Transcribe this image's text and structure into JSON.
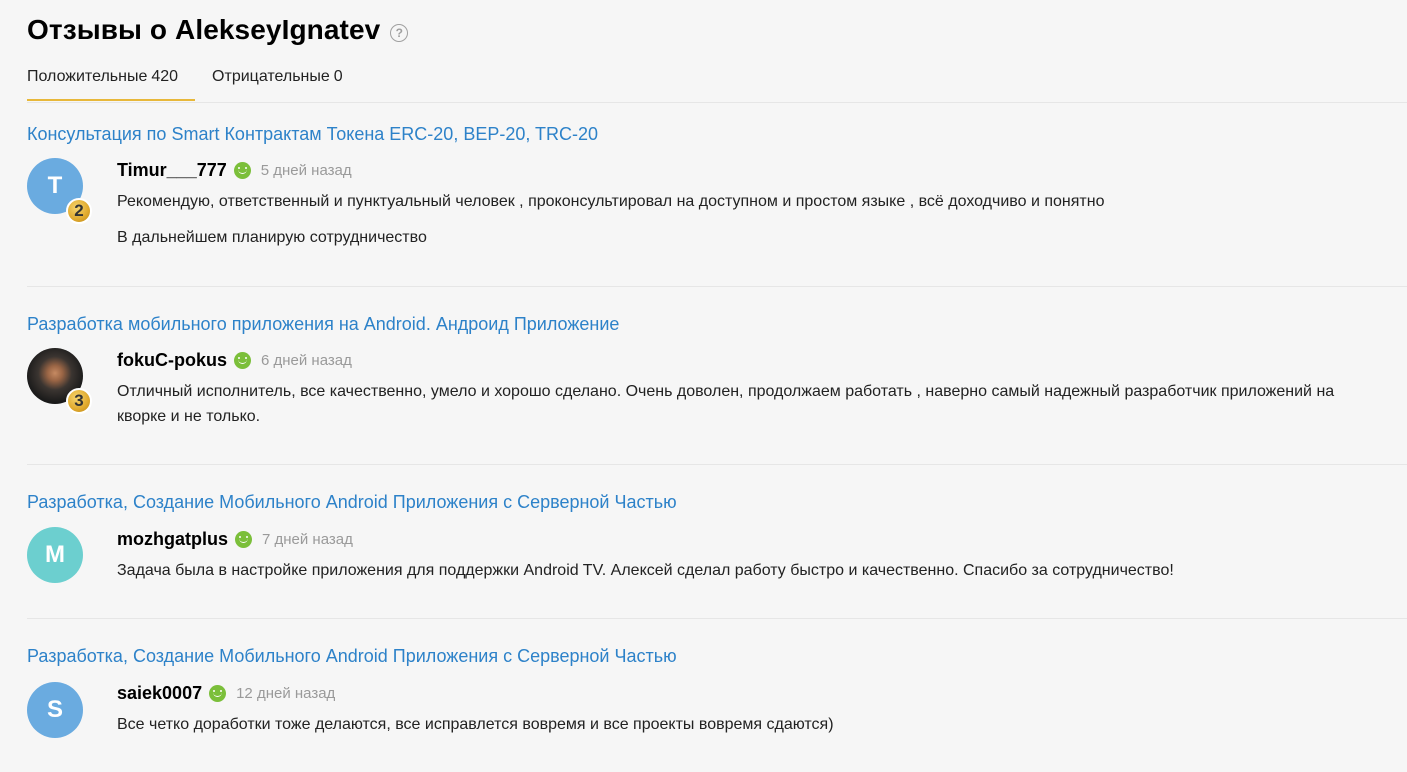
{
  "header": {
    "title": "Отзывы о AlekseyIgnatev",
    "help_glyph": "?"
  },
  "tabs": [
    {
      "label": "Положительные",
      "count": "420",
      "active": true
    },
    {
      "label": "Отрицательные",
      "count": "0",
      "active": false
    }
  ],
  "reviews": [
    {
      "gig_title": "Консультация по Smart Контрактам Токена ERC-20, BEP-20, TRC-20",
      "author": "Timur___777",
      "avatar_letter": "T",
      "avatar_color": "#6aabe0",
      "level": "2",
      "time": "5 дней назад",
      "text": [
        "Рекомендую, ответственный и пунктуальный человек , проконсультировал на доступном и простом языке , всё доходчиво и понятно",
        "В дальнейшем планирую сотрудничество"
      ]
    },
    {
      "gig_title": "Разработка мобильного приложения на Android. Андроид Приложение",
      "author": "fokuC-pokus",
      "avatar_letter": "",
      "avatar_color": "#2a2a2a",
      "level": "3",
      "time": "6 дней назад",
      "text": [
        "Отличный исполнитель, все качественно, умело и хорошо сделано. Очень доволен, продолжаем работать , наверно самый надежный разработчик приложений на кворке и не только."
      ]
    },
    {
      "gig_title": "Разработка, Создание Мобильного Android Приложения с Серверной Частью",
      "author": "mozhgatplus",
      "avatar_letter": "M",
      "avatar_color": "#6ccfcf",
      "level": "",
      "time": "7 дней назад",
      "text": [
        "Задача была в настройке приложения для поддержки Android TV. Алексей сделал работу быстро и качественно. Спасибо за сотрудничество!"
      ]
    },
    {
      "gig_title": "Разработка, Создание Мобильного Android Приложения с Серверной Частью",
      "author": "saiek0007",
      "avatar_letter": "S",
      "avatar_color": "#6aabe0",
      "level": "",
      "time": "12 дней назад",
      "text": [
        "Все четко доработки тоже делаются, все исправлется вовремя и все проекты вовремя сдаются)"
      ]
    }
  ],
  "colors": {
    "link": "#2d82c9",
    "tab_underline": "#e8b83a",
    "positive_icon": "#7bbf3a"
  }
}
